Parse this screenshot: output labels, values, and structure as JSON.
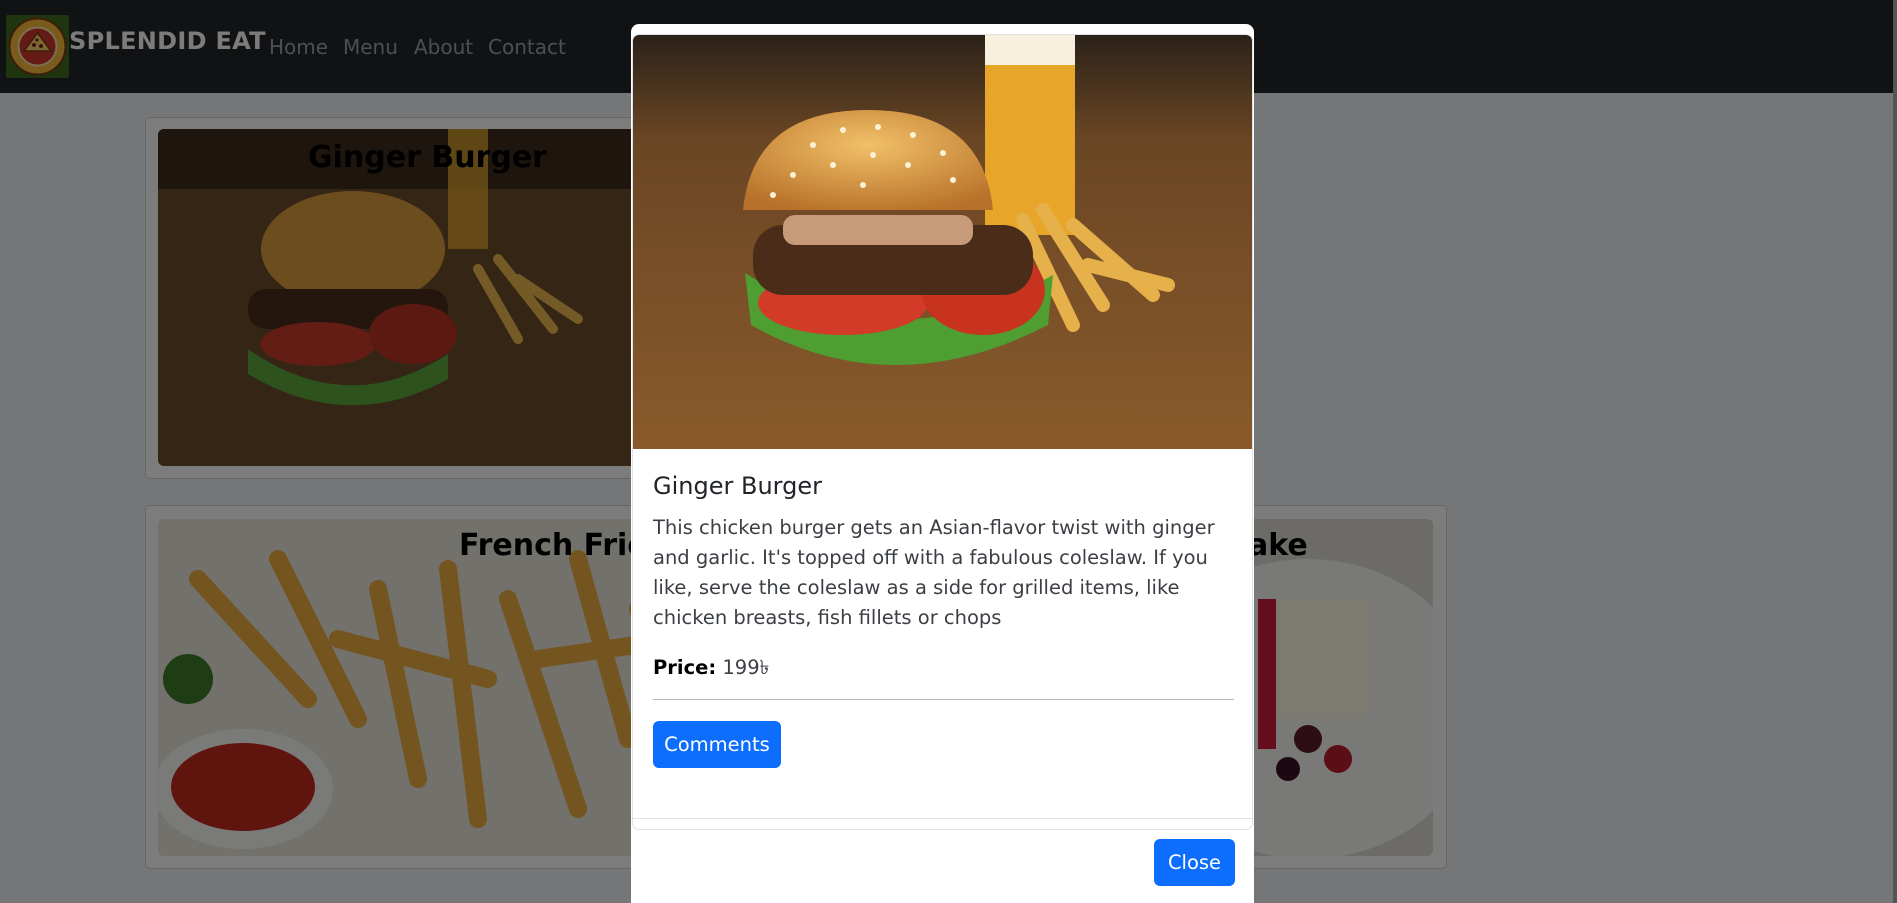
{
  "navbar": {
    "brand": "SPLENDID EAT",
    "links": [
      "Home",
      "Menu",
      "About",
      "Contact"
    ]
  },
  "cards": [
    {
      "title": "Ginger Burger"
    },
    {
      "title": "French Fries"
    },
    {
      "title": "ake"
    }
  ],
  "modal": {
    "title": "Ginger Burger",
    "description": "This chicken burger gets an Asian-flavor twist with ginger and garlic. It's topped off with a fabulous coleslaw. If you like, serve the coleslaw as a side for grilled items, like chicken breasts, fish fillets or chops",
    "price_label": "Price:",
    "price_value": "199৳",
    "comments_button": "Comments",
    "close_button": "Close"
  },
  "colors": {
    "navbar": "#212529",
    "primary_button": "#0d6efd",
    "backdrop": "rgba(0,0,0,0.5)"
  }
}
